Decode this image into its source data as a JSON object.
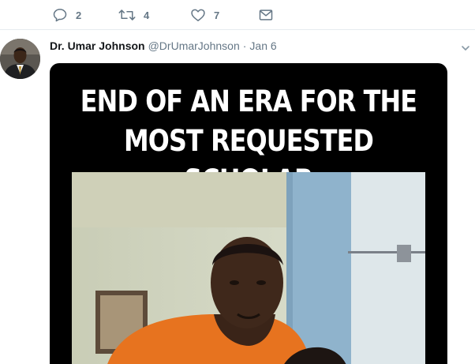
{
  "previous_tweet": {
    "actions": {
      "reply_count": "2",
      "retweet_count": "4",
      "like_count": "7"
    }
  },
  "tweet": {
    "display_name": "Dr. Umar Johnson",
    "handle": "@DrUmarJohnson",
    "separator": "·",
    "timestamp": "Jan 6",
    "media": {
      "title_line1": "END OF AN ERA FOR THE",
      "title_line2": "MOST REQUESTED SCHOLAR"
    }
  },
  "icons": {
    "reply": "reply-icon",
    "retweet": "retweet-icon",
    "like": "heart-icon",
    "dm": "envelope-icon",
    "more": "chevron-down-icon"
  },
  "colors": {
    "icon_gray": "#657786",
    "name": "#14171a",
    "divider": "#e6ecf0"
  }
}
